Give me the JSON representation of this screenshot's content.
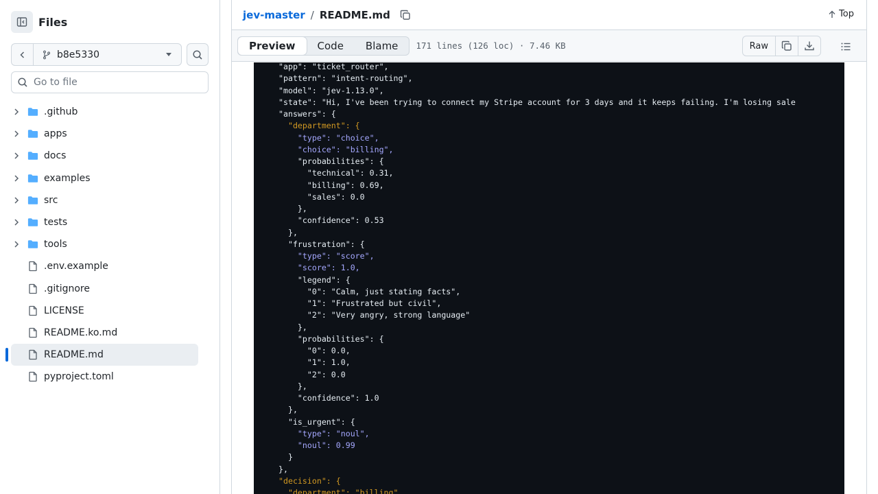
{
  "sidebar": {
    "title": "Files",
    "branch": "b8e5330",
    "goto_placeholder": "Go to file",
    "items": [
      {
        "label": ".github",
        "type": "folder"
      },
      {
        "label": "apps",
        "type": "folder"
      },
      {
        "label": "docs",
        "type": "folder"
      },
      {
        "label": "examples",
        "type": "folder"
      },
      {
        "label": "src",
        "type": "folder"
      },
      {
        "label": "tests",
        "type": "folder"
      },
      {
        "label": "tools",
        "type": "folder"
      },
      {
        "label": ".env.example",
        "type": "file"
      },
      {
        "label": ".gitignore",
        "type": "file"
      },
      {
        "label": "LICENSE",
        "type": "file"
      },
      {
        "label": "README.ko.md",
        "type": "file"
      },
      {
        "label": "README.md",
        "type": "file",
        "selected": true
      },
      {
        "label": "pyproject.toml",
        "type": "file"
      }
    ]
  },
  "header": {
    "repo": "jev-master",
    "separator": "/",
    "file": "README.md",
    "top_label": "Top"
  },
  "toolbar": {
    "tabs": [
      "Preview",
      "Code",
      "Blame"
    ],
    "active_tab": "Preview",
    "meta": "171 lines (126 loc) · 7.46 KB",
    "raw_label": "Raw"
  },
  "code_lines": [
    "\"app\": \"ticket_router\",",
    "\"pattern\": \"intent-routing\",",
    "\"model\": \"jev-1.13.0\",",
    "\"state\": \"Hi, I've been trying to connect my Stripe account for 3 days and it keeps failing. I'm losing sale",
    "\"answers\": {",
    "  \"department\": {",
    "    \"type\": \"choice\",",
    "    \"choice\": \"billing\",",
    "    \"probabilities\": {",
    "      \"technical\": 0.31,",
    "      \"billing\": 0.69,",
    "      \"sales\": 0.0",
    "    },",
    "    \"confidence\": 0.53",
    "  },",
    "  \"frustration\": {",
    "    \"type\": \"score\",",
    "    \"score\": 1.0,",
    "    \"legend\": {",
    "      \"0\": \"Calm, just stating facts\",",
    "      \"1\": \"Frustrated but civil\",",
    "      \"2\": \"Very angry, strong language\"",
    "    },",
    "    \"probabilities\": {",
    "      \"0\": 0.0,",
    "      \"1\": 1.0,",
    "      \"2\": 0.0",
    "    },",
    "    \"confidence\": 1.0",
    "  },",
    "  \"is_urgent\": {",
    "    \"type\": \"noul\",",
    "    \"noul\": 0.99",
    "  }",
    "},",
    "\"decision\": {",
    "  \"department\": \"billing\","
  ],
  "line_styles": [
    "k",
    "k",
    "k",
    "k",
    "k",
    "ky",
    "kv",
    "kv",
    "k",
    "k",
    "k",
    "k",
    "k",
    "k",
    "k",
    "k",
    "kv",
    "kv",
    "k",
    "k",
    "k",
    "k",
    "k",
    "k",
    "k",
    "k",
    "k",
    "k",
    "k",
    "k",
    "k",
    "kv",
    "kv",
    "k",
    "k",
    "ky",
    "ky"
  ],
  "colors": {
    "accent": "#0969da",
    "code_bg": "#0d1117"
  }
}
